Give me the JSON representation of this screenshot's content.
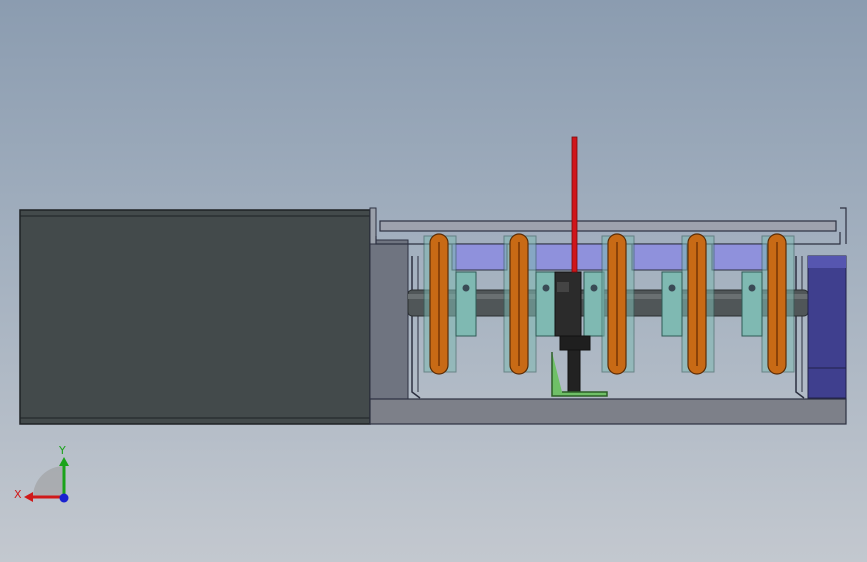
{
  "viewport": {
    "background_top": "#8b9cb0",
    "background_bottom": "#c3c8cf"
  },
  "model": {
    "motor_color": "#434a4b",
    "housing_color": "#6f7480",
    "base_color": "#7d8089",
    "frame_line_color": "#2c3040",
    "plate_color": "#8f91dc",
    "shaft_color": "#505658",
    "hub_color": "#7fb9b2",
    "ring_color": "#c86a15",
    "needle_color": "#d0151a",
    "clamp_color": "#2b2b2b",
    "bracket_color": "#6fc067",
    "end_block_color": "#3f3f8e",
    "ring_count": 5,
    "hub_count": 5
  },
  "triad": {
    "x_label": "X",
    "y_label": "Y",
    "x_color": "#d01919",
    "y_color": "#1aa31a",
    "z_color": "#1a22d0"
  }
}
